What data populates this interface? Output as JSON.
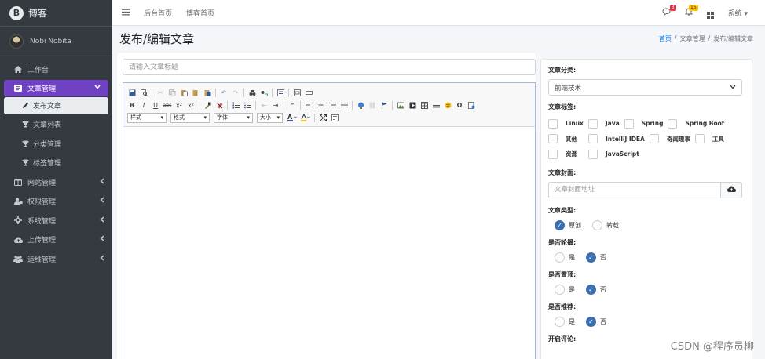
{
  "brand": {
    "logo_letter": "B",
    "name": "博客"
  },
  "user": {
    "name": "Nobi Nobita"
  },
  "sidebar": {
    "items": [
      {
        "label": "工作台",
        "icon": "home-icon",
        "expandable": false
      },
      {
        "label": "文章管理",
        "icon": "article-icon",
        "expandable": true,
        "active": true
      },
      {
        "label": "网站管理",
        "icon": "columns-icon",
        "expandable": true
      },
      {
        "label": "权限管理",
        "icon": "users-cog-icon",
        "expandable": true
      },
      {
        "label": "系统管理",
        "icon": "gear-icon",
        "expandable": true
      },
      {
        "label": "上传管理",
        "icon": "cloud-upload-icon",
        "expandable": true
      },
      {
        "label": "运维管理",
        "icon": "people-icon",
        "expandable": true
      }
    ],
    "sub_items": [
      {
        "label": "发布文章",
        "icon": "pen-icon",
        "selected": true
      },
      {
        "label": "文章列表",
        "icon": "trophy-icon"
      },
      {
        "label": "分类管理",
        "icon": "trophy-icon"
      },
      {
        "label": "标签管理",
        "icon": "trophy-icon"
      }
    ]
  },
  "topbar": {
    "links": [
      "后台首页",
      "博客首页"
    ],
    "message_badge": "3",
    "notification_badge": "15",
    "system_label": "系统"
  },
  "header": {
    "title": "发布/编辑文章",
    "breadcrumb": [
      "首页",
      "文章管理",
      "发布/编辑文章"
    ]
  },
  "editor": {
    "title_placeholder": "请输入文章标题",
    "dropdowns": [
      "样式",
      "格式",
      "字体",
      "大小"
    ]
  },
  "form": {
    "category_label": "文章分类:",
    "category_value": "前端技术",
    "tags_label": "文章标签:",
    "tags": [
      "Linux",
      "Java",
      "Spring",
      "Spring Boot",
      "其他",
      "IntelliJ IDEA",
      "奇闻趣事",
      "工具",
      "资源",
      "JavaScript"
    ],
    "cover_label": "文章封面:",
    "cover_placeholder": "文章封面地址",
    "type_label": "文章类型:",
    "type_options": [
      "原创",
      "转载"
    ],
    "type_selected": "原创",
    "carousel_label": "是否轮播:",
    "top_label": "是否置顶:",
    "recommend_label": "是否推荐:",
    "yes": "是",
    "no": "否",
    "comment_label": "开启评论:"
  },
  "colors": {
    "sidebar_bg": "#343a40",
    "accent_purple": "#6f42c1",
    "radio_blue": "#3a6fb0",
    "link_blue": "#007bff"
  },
  "watermark": "CSDN @程序员柳"
}
